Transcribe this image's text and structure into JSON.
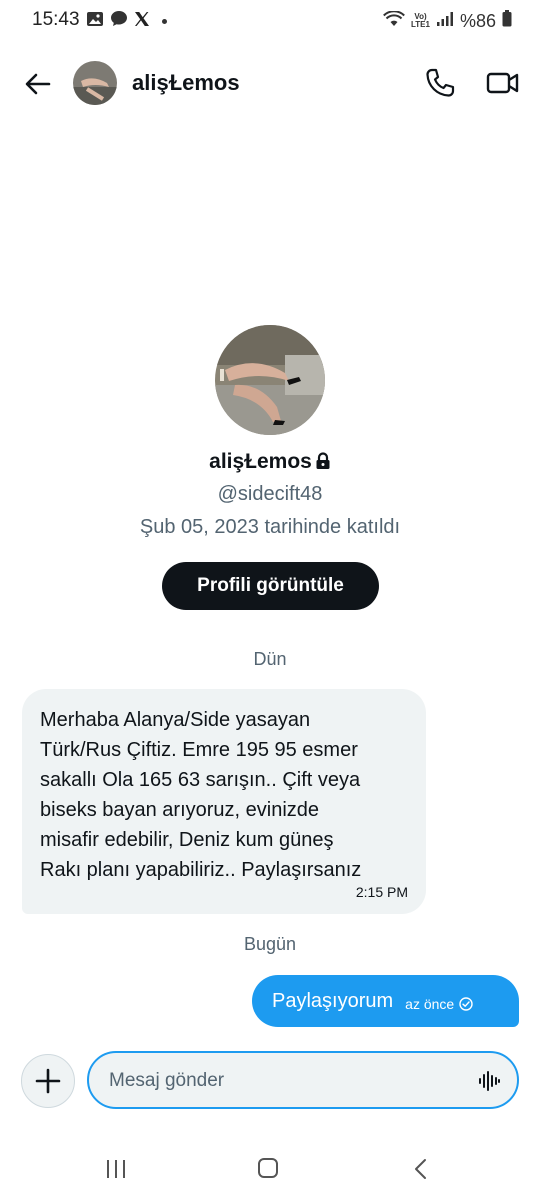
{
  "status_bar": {
    "time": "15:43",
    "volte": "Vo)",
    "lte": "LTE1",
    "battery": "%86"
  },
  "header": {
    "name": "alişⱢemos"
  },
  "profile": {
    "name": "alişⱢemos",
    "handle": "@sidecift48",
    "joined": "Şub 05, 2023 tarihinde katıldı",
    "view_button": "Profili görüntüle"
  },
  "messages": {
    "day1": "Dün",
    "incoming_text": "Merhaba Alanya/Side yasayan\nTürk/Rus Çiftiz. Emre 195 95 esmer\nsakallı Ola 165 63 sarışın.. Çift veya\nbiseks bayan arıyoruz, evinizde\nmisafir edebilir, Deniz kum güneş\nRakı planı yapabiliriz.. Paylaşırsanız",
    "incoming_time": "2:15 PM",
    "day2": "Bugün",
    "outgoing_text": "Paylaşıyorum",
    "outgoing_time": "az önce"
  },
  "composer": {
    "placeholder": "Mesaj gönder"
  },
  "colors": {
    "accent": "#1d9bf0",
    "bubble_incoming": "#eff3f4",
    "text_secondary": "#536471"
  }
}
